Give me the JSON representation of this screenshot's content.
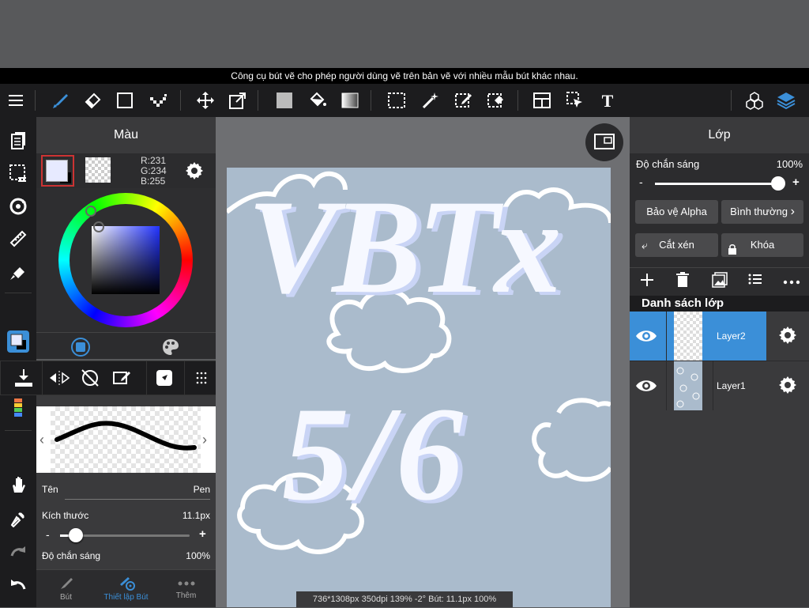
{
  "tip": "Công cụ bút vẽ cho phép người dùng vẽ trên bản vẽ với nhiều mẫu bút khác nhau.",
  "colors": {
    "accent": "#3b8fd8",
    "fg_swatch": "#e7eaff",
    "bg_dark": "#1c1c1e"
  },
  "color_panel": {
    "title": "Màu",
    "rgb": {
      "r": "R:231",
      "g": "G:234",
      "b": "B:255"
    }
  },
  "brush": {
    "name_label": "Tên",
    "name_value": "Pen",
    "size_label": "Kích thước",
    "size_value": "11.1px",
    "size_minus": "-",
    "size_plus": "+",
    "opacity_label": "Độ chắn sáng",
    "opacity_value": "100%",
    "size_level": 0.12
  },
  "bottom_tabs": [
    {
      "label": "Bút",
      "icon": "brush-icon"
    },
    {
      "label": "Thiết lập Bút",
      "icon": "brush-settings-icon"
    },
    {
      "label": "Thêm",
      "icon": "more-icon"
    }
  ],
  "status": "736*1308px 350dpi 139% -2° Bút: 11.1px 100%",
  "layer_panel": {
    "title": "Lớp",
    "opacity_label": "Độ chắn sáng",
    "opacity_value": "100%",
    "opacity_minus": "-",
    "opacity_plus": "+",
    "opacity_level": 1.0,
    "alpha_protect": "Bảo vệ Alpha",
    "blend_mode": "Bình thường",
    "clip": "Cắt xén",
    "lock": "Khóa",
    "list_title": "Danh sách lớp",
    "layers": [
      {
        "name": "Layer2",
        "selected": true
      },
      {
        "name": "Layer1",
        "selected": false
      }
    ]
  },
  "canvas_text": {
    "line1": "VBTx",
    "line2": "5/6"
  }
}
